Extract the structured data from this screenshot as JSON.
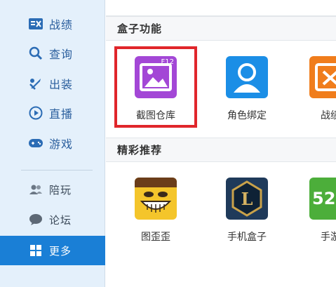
{
  "sidebar": {
    "items": [
      {
        "label": "战绩"
      },
      {
        "label": "查询"
      },
      {
        "label": "出装"
      },
      {
        "label": "直播"
      },
      {
        "label": "游戏"
      },
      {
        "label": "陪玩"
      },
      {
        "label": "论坛"
      },
      {
        "label": "更多"
      }
    ],
    "active_item": "更多"
  },
  "sections": {
    "features": {
      "title": "盒子功能",
      "tiles": [
        {
          "label": "截图仓库",
          "badge": "F12",
          "icon": "screenshot-gallery-icon"
        },
        {
          "label": "角色绑定",
          "icon": "user-bind-icon"
        },
        {
          "label": "战绩",
          "icon": "record-icon"
        }
      ]
    },
    "recommend": {
      "title": "精彩推荐",
      "tiles": [
        {
          "label": "图歪歪",
          "icon": "cartoon-face-icon"
        },
        {
          "label": "手机盒子",
          "badge": "L",
          "icon": "mobile-box-icon"
        },
        {
          "label": "手游",
          "badge": "52",
          "icon": "mobile-game-icon"
        }
      ]
    }
  },
  "colors": {
    "sidebar_bg": "#e4f0fb",
    "accent": "#1a7fd6",
    "highlight": "#e0262b"
  }
}
